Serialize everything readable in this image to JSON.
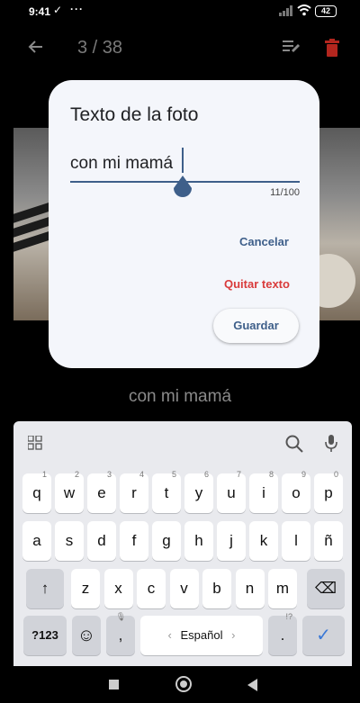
{
  "status": {
    "time": "9:41",
    "check": "✓",
    "dots": "···",
    "battery": "42"
  },
  "appbar": {
    "counter": "3 / 38",
    "accent": "#b3261e"
  },
  "caption": "con mi mamá",
  "dialog": {
    "title": "Texto de la foto",
    "value": "con mi mamá",
    "counter": "11/100",
    "cancel": "Cancelar",
    "remove": "Quitar texto",
    "save": "Guardar",
    "colors": {
      "primary": "#3e5f8a",
      "danger": "#d93b3b"
    }
  },
  "keyboard": {
    "row1": [
      {
        "k": "q",
        "h": "1"
      },
      {
        "k": "w",
        "h": "2"
      },
      {
        "k": "e",
        "h": "3"
      },
      {
        "k": "r",
        "h": "4"
      },
      {
        "k": "t",
        "h": "5"
      },
      {
        "k": "y",
        "h": "6"
      },
      {
        "k": "u",
        "h": "7"
      },
      {
        "k": "i",
        "h": "8"
      },
      {
        "k": "o",
        "h": "9"
      },
      {
        "k": "p",
        "h": "0"
      }
    ],
    "row2": [
      "a",
      "s",
      "d",
      "f",
      "g",
      "h",
      "j",
      "k",
      "l",
      "ñ"
    ],
    "row3": [
      "z",
      "x",
      "c",
      "v",
      "b",
      "n",
      "m"
    ],
    "shift": "↑",
    "backspace": "⌫",
    "sym": "?123",
    "emoji": "☺",
    "comma": ",",
    "space": "Español",
    "space_left": "‹",
    "space_right": "›",
    "period": ".",
    "period_hint": "!?",
    "enter": "✓"
  }
}
